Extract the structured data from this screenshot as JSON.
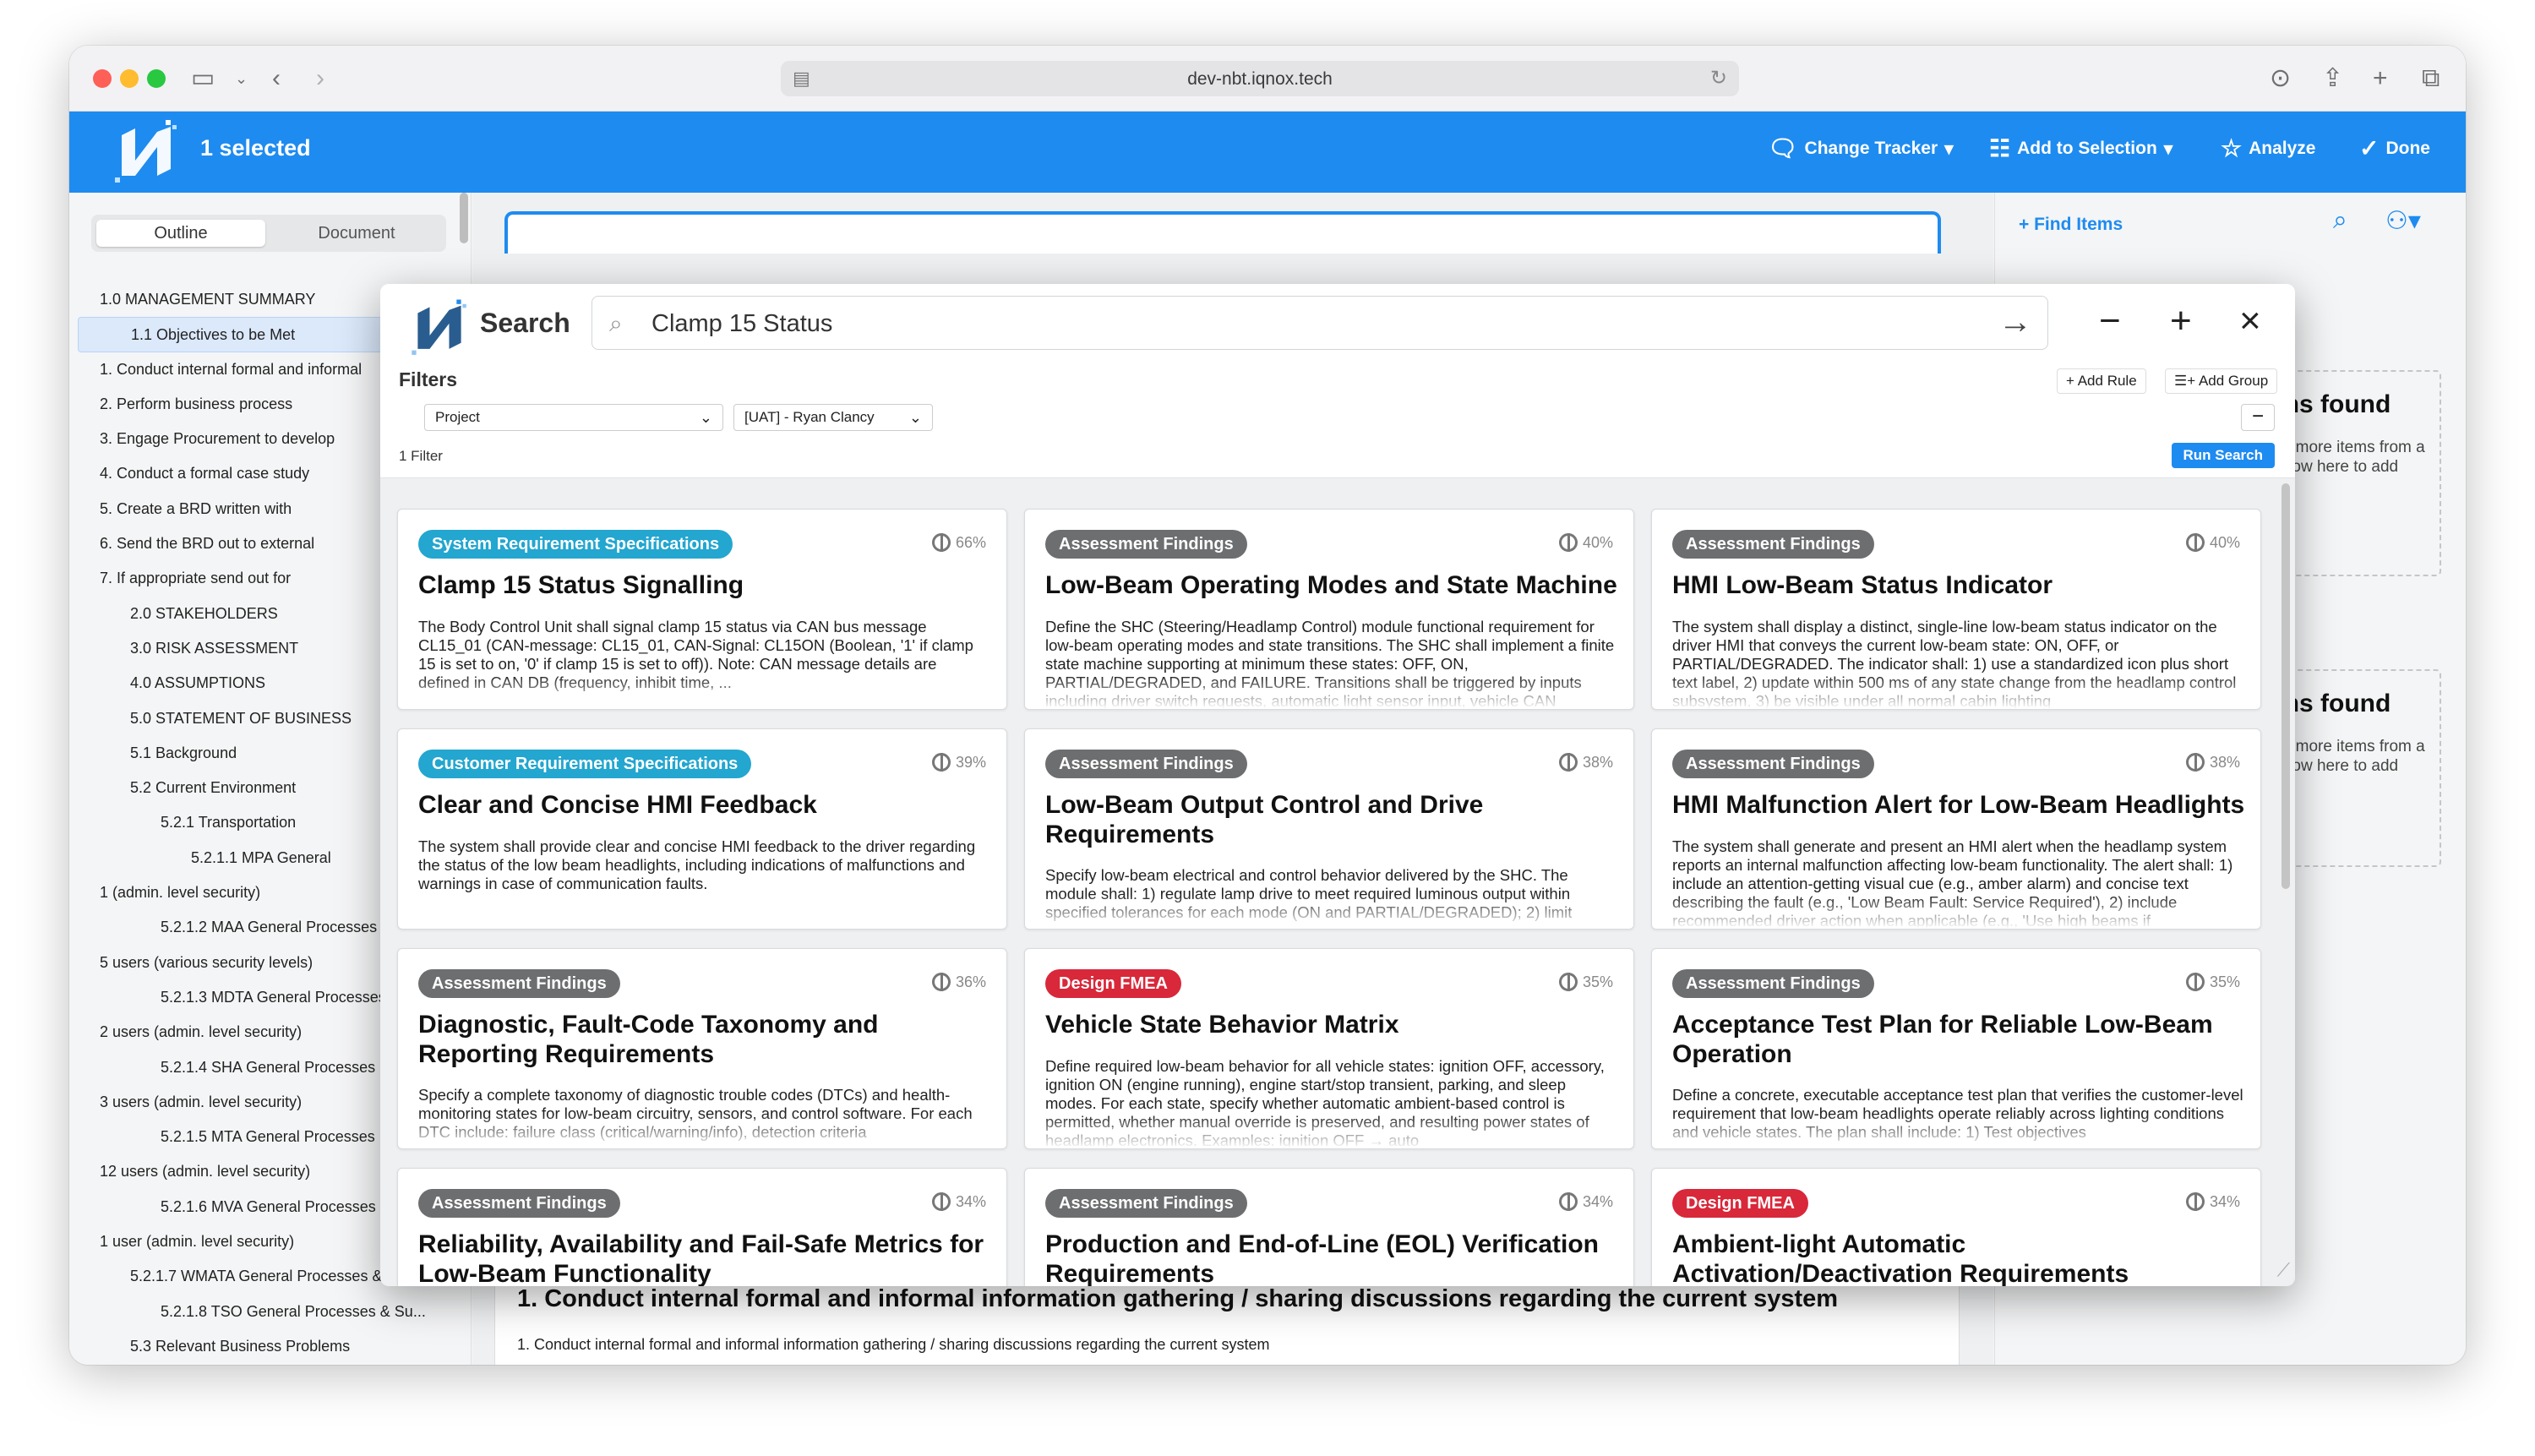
{
  "browser": {
    "url": "dev-nbt.iqnox.tech"
  },
  "header": {
    "selected_text": "1 selected",
    "change_tracker": "Change Tracker",
    "add_to_selection": "Add to Selection",
    "analyze": "Analyze",
    "done": "Done"
  },
  "outline": {
    "tabs": [
      "Outline",
      "Document"
    ],
    "items": [
      "1.0 MANAGEMENT SUMMARY",
      "1.1 Objectives to be Met",
      "1. Conduct internal formal and informal",
      "2. Perform business process",
      "3. Engage Procurement to develop",
      "4. Conduct a formal case study",
      "5. Create a BRD written with",
      "6. Send the BRD out to external",
      "7. If appropriate send out for",
      "2.0 STAKEHOLDERS",
      "3.0 RISK ASSESSMENT",
      "4.0 ASSUMPTIONS",
      "5.0 STATEMENT OF BUSINESS",
      "5.1 Background",
      "5.2 Current Environment",
      "5.2.1 Transportation",
      "5.2.1.1 MPA General",
      "1 (admin. level security)",
      "5.2.1.2 MAA General Processes",
      "5 users (various security levels)",
      "5.2.1.3 MDTA General Processes",
      "2 users (admin. level security)",
      "5.2.1.4 SHA General Processes",
      "3 users (admin. level security)",
      "5.2.1.5 MTA General Processes",
      "12 users (admin. level security)",
      "5.2.1.6 MVA General Processes",
      "1 user (admin. level security)",
      "5.2.1.7 WMATA General Processes & Su...",
      "5.2.1.8 TSO General Processes & Su...",
      "5.3 Relevant Business Problems"
    ]
  },
  "document": {
    "section_title": "1. Conduct internal formal and informal information gathering / sharing discussions regarding the current system",
    "section_body": "1. Conduct internal formal and informal information gathering / sharing discussions regarding the current system"
  },
  "right_panel": {
    "find_items": "Find Items",
    "empty_title": "No items found",
    "empty_text": "Drop one or more items from a search window here to add them."
  },
  "search": {
    "title": "Search",
    "query": "Clamp 15 Status",
    "filters_label": "Filters",
    "add_rule": "Add Rule",
    "add_group": "Add Group",
    "filter_field": "Project",
    "filter_value": "[UAT] - Ryan Clancy",
    "filter_count": "1 Filter",
    "run_search": "Run Search"
  },
  "results": [
    {
      "badge": "System Requirement Specifications",
      "badge_type": "sys",
      "pct": "66%",
      "title": "Clamp 15 Status Signalling",
      "desc": "The Body Control Unit shall signal clamp 15 status via CAN bus message CL15_01 (CAN-message: CL15_01, CAN-Signal: CL15ON (Boolean, '1' if clamp 15 is set to on, '0' if clamp 15 is set to off)). Note: CAN message details are defined in CAN DB (frequency, inhibit time, ..."
    },
    {
      "badge": "Assessment Findings",
      "badge_type": "assess",
      "pct": "40%",
      "title": "Low-Beam Operating Modes and State Machine",
      "desc": "Define the SHC (Steering/Headlamp Control) module functional requirement for low-beam operating modes and state transitions. The SHC shall implement a finite state machine supporting at minimum these states: OFF, ON, PARTIAL/DEGRADED, and FAILURE. Transitions shall be triggered by inputs including driver switch requests, automatic light sensor input, vehicle CAN"
    },
    {
      "badge": "Assessment Findings",
      "badge_type": "assess",
      "pct": "40%",
      "title": "HMI Low-Beam Status Indicator",
      "desc": "The system shall display a distinct, single-line low-beam status indicator on the driver HMI that conveys the current low-beam state: ON, OFF, or PARTIAL/DEGRADED. The indicator shall: 1) use a standardized icon plus short text label, 2) update within 500 ms of any state change from the headlamp control subsystem, 3) be visible under all normal cabin lighting"
    },
    {
      "badge": "Customer Requirement Specifications",
      "badge_type": "cust",
      "pct": "39%",
      "title": "Clear and Concise HMI Feedback",
      "desc": "The system shall provide clear and concise HMI feedback to the driver regarding the status of the low beam headlights, including indications of malfunctions and warnings in case of communication faults."
    },
    {
      "badge": "Assessment Findings",
      "badge_type": "assess",
      "pct": "38%",
      "title": "Low-Beam Output Control and Drive Requirements",
      "desc": "Specify low-beam electrical and control behavior delivered by the SHC. The module shall: 1) regulate lamp drive to meet required luminous output within specified tolerances for each mode (ON and PARTIAL/DEGRADED); 2) limit"
    },
    {
      "badge": "Assessment Findings",
      "badge_type": "assess",
      "pct": "38%",
      "title": "HMI Malfunction Alert for Low-Beam Headlights",
      "desc": "The system shall generate and present an HMI alert when the headlamp system reports an internal malfunction affecting low-beam functionality. The alert shall: 1) include an attention-getting visual cue (e.g., amber alarm) and concise text describing the fault (e.g., 'Low Beam Fault: Service Required'), 2) include recommended driver action when applicable (e.g., 'Use high beams if"
    },
    {
      "badge": "Assessment Findings",
      "badge_type": "assess",
      "pct": "36%",
      "title": "Diagnostic, Fault-Code Taxonomy and Reporting Requirements",
      "desc": "Specify a complete taxonomy of diagnostic trouble codes (DTCs) and health-monitoring states for low-beam circuitry, sensors, and control software. For each DTC include: failure class (critical/warning/info), detection criteria"
    },
    {
      "badge": "Design FMEA",
      "badge_type": "fmea",
      "pct": "35%",
      "title": "Vehicle State Behavior Matrix",
      "desc": "Define required low-beam behavior for all vehicle states: ignition OFF, accessory, ignition ON (engine running), engine start/stop transient, parking, and sleep modes. For each state, specify whether automatic ambient-based control is permitted, whether manual override is preserved, and resulting power states of headlamp electronics. Examples: ignition OFF → auto"
    },
    {
      "badge": "Assessment Findings",
      "badge_type": "assess",
      "pct": "35%",
      "title": "Acceptance Test Plan for Reliable Low-Beam Operation",
      "desc": "Define a concrete, executable acceptance test plan that verifies the customer-level requirement that low-beam headlights operate reliably across lighting conditions and vehicle states. The plan shall include: 1) Test objectives"
    },
    {
      "badge": "Assessment Findings",
      "badge_type": "assess",
      "pct": "34%",
      "title": "Reliability, Availability and Fail-Safe Metrics for Low-Beam Functionality",
      "desc": ""
    },
    {
      "badge": "Assessment Findings",
      "badge_type": "assess",
      "pct": "34%",
      "title": "Production and End-of-Line (EOL) Verification Requirements",
      "desc": ""
    },
    {
      "badge": "Design FMEA",
      "badge_type": "fmea",
      "pct": "34%",
      "title": "Ambient-light Automatic Activation/Deactivation Requirements",
      "desc": ""
    }
  ],
  "colors": {
    "brand_blue": "#1e8bf0",
    "badge_spec": "#23a6cf",
    "badge_assessment": "#6d6e70",
    "badge_fmea": "#d8283a"
  }
}
